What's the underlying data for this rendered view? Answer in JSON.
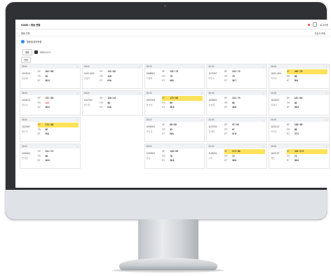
{
  "screen": {
    "breadcrumb": "HOME > 병동 현황",
    "topright": "로그아웃",
    "subbar_left": "병동   전체",
    "subbar_right": "간호사  조회",
    "section_title": "병동별 환자현황",
    "filter_label": "병동",
    "filter_date": "2020.11.17",
    "tab_label": "전체"
  },
  "cards": [
    {
      "time": "08:00",
      "room": "1103101",
      "sub": "홍길동",
      "rows": [
        {
          "lab": "BP",
          "val": "162 / 80",
          "hl": false
        },
        {
          "lab": "PR",
          "val": "82",
          "hl": false
        },
        {
          "lab": "BT",
          "val": "36.6",
          "hl": false
        }
      ]
    },
    {
      "time": "08:00",
      "room": "1102-1001",
      "sub": "김철수",
      "rows": [
        {
          "lab": "BP",
          "val": "131 / 82",
          "hl": false
        },
        {
          "lab": "PR",
          "val": "108",
          "hl": false
        },
        {
          "lab": "BT",
          "val": "N/A",
          "hl": false
        }
      ]
    },
    {
      "time": "08:00",
      "room": "1088901",
      "sub": "이영희",
      "rows": [
        {
          "lab": "BP",
          "val": "121 / 76",
          "hl": false
        },
        {
          "lab": "PR",
          "val": "75",
          "hl": false
        },
        {
          "lab": "BT",
          "val": "N/A",
          "hl": false
        }
      ]
    },
    {
      "time": "08:00",
      "room": "1107307",
      "sub": "박민수",
      "rows": [
        {
          "lab": "BP",
          "val": "131 / 72",
          "hl": false
        },
        {
          "lab": "PR",
          "val": "75",
          "hl": false
        },
        {
          "lab": "BT",
          "val": "36.7",
          "hl": false
        }
      ]
    },
    {
      "time": "08:00",
      "room": "1105-1001",
      "sub": "최지우",
      "rows": [
        {
          "lab": "BP",
          "val": "162 / 78",
          "hl": true
        },
        {
          "lab": "PR",
          "val": "88",
          "hl": false
        },
        {
          "lab": "BT",
          "val": "N/A",
          "hl": false
        }
      ]
    },
    {
      "time": "08:00",
      "room": "1105101",
      "sub": "정수진",
      "rows": [
        {
          "lab": "BP",
          "val": "121 / 65",
          "hl": false
        },
        {
          "lab": "PR",
          "val": "103",
          "hl": false,
          "red": true
        },
        {
          "lab": "BT",
          "val": "36.6",
          "hl": false
        }
      ]
    },
    {
      "time": "08:00",
      "room": "1107202",
      "sub": "한지민",
      "rows": [
        {
          "lab": "BP",
          "val": "126 / 44",
          "hl": false
        },
        {
          "lab": "PR",
          "val": "88",
          "hl": false
        },
        {
          "lab": "BT",
          "val": "N/A",
          "hl": false
        }
      ]
    },
    {
      "time": "08:00",
      "room": "1097003",
      "sub": "윤서연",
      "rows": [
        {
          "lab": "BP",
          "val": "173 / 88",
          "hl": true
        },
        {
          "lab": "PR",
          "val": "89",
          "hl": false
        },
        {
          "lab": "BT",
          "val": "36.6",
          "hl": false
        }
      ]
    },
    {
      "time": "08:00",
      "room": "1095201",
      "sub": "강동원",
      "rows": [
        {
          "lab": "BP",
          "val": "121 / 70",
          "hl": false
        },
        {
          "lab": "PR",
          "val": "85",
          "hl": false
        },
        {
          "lab": "BT",
          "val": "36.6",
          "hl": false
        }
      ]
    },
    {
      "time": "08:00",
      "room": "1103007",
      "sub": "송혜교",
      "rows": [
        {
          "lab": "BP",
          "val": "131 / 64",
          "hl": false
        },
        {
          "lab": "PR",
          "val": "82",
          "hl": false
        },
        {
          "lab": "BT",
          "val": "36.6",
          "hl": false
        }
      ]
    },
    {
      "time": "08:00",
      "room": "1103047",
      "sub": "배수지",
      "rows": [
        {
          "lab": "BP",
          "val": "172 / 88",
          "hl": true
        },
        {
          "lab": "PR",
          "val": "80",
          "hl": false
        },
        {
          "lab": "BT",
          "val": "N/A",
          "hl": false
        }
      ]
    },
    {
      "empty": true
    },
    {
      "time": "08:00",
      "room": "1099001",
      "sub": "조인성",
      "rows": [
        {
          "lab": "BP",
          "val": "88 / 60",
          "hl": false
        },
        {
          "lab": "PR",
          "val": "62",
          "hl": false
        },
        {
          "lab": "BT",
          "val": "N/A",
          "hl": false
        }
      ]
    },
    {
      "time": "08:00",
      "room": "1107001",
      "sub": "김태희",
      "rows": [
        {
          "lab": "BP",
          "val": "97 / 60",
          "hl": false
        },
        {
          "lab": "PR",
          "val": "67",
          "hl": false
        },
        {
          "lab": "BT",
          "val": "37.8",
          "hl": false
        }
      ]
    },
    {
      "time": "08:00",
      "room": "1102107",
      "sub": "이민호",
      "rows": [
        {
          "lab": "BP",
          "val": "138 / 85",
          "hl": false
        },
        {
          "lab": "PR",
          "val": "88",
          "hl": false
        },
        {
          "lab": "BT",
          "val": "37.0",
          "hl": false
        }
      ]
    },
    {
      "time": "08:00",
      "room": "1105401",
      "sub": "전지현",
      "rows": [
        {
          "lab": "BP",
          "val": "131 / 72",
          "hl": false
        },
        {
          "lab": "PR",
          "val": "85",
          "hl": false
        },
        {
          "lab": "BT",
          "val": "36.6",
          "hl": false
        }
      ]
    },
    {
      "empty": true
    },
    {
      "time": "08:00",
      "room": "1100503",
      "sub": "공유",
      "rows": [
        {
          "lab": "BP",
          "val": "108 / 85",
          "hl": false
        },
        {
          "lab": "PR",
          "val": "78",
          "hl": false
        },
        {
          "lab": "BT",
          "val": "36.6",
          "hl": false
        }
      ]
    },
    {
      "time": "08:00",
      "room": "1108201",
      "sub": "수지",
      "rows": [
        {
          "lab": "BP",
          "val": "171 / 88",
          "hl": true
        },
        {
          "lab": "PR",
          "val": "72",
          "hl": false
        },
        {
          "lab": "BT",
          "val": "36.6",
          "hl": false
        }
      ]
    },
    {
      "time": "08:00",
      "room": "1102107",
      "sub": "현빈",
      "rows": [
        {
          "lab": "BP",
          "val": "151 / 172",
          "hl": true
        },
        {
          "lab": "PR",
          "val": "73",
          "hl": false
        },
        {
          "lab": "BT",
          "val": "36.6",
          "hl": false
        }
      ]
    }
  ]
}
